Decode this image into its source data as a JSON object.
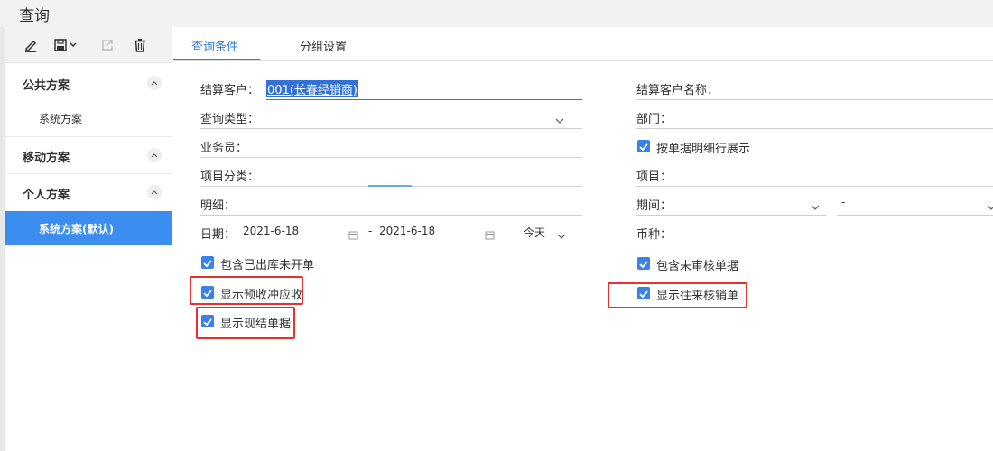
{
  "window": {
    "title": "查询"
  },
  "toolbar": {
    "icons": [
      "edit-icon",
      "save-icon",
      "export-icon",
      "delete-icon"
    ]
  },
  "sidebar": {
    "groups": [
      {
        "label": "公共方案",
        "items": [
          "系统方案"
        ]
      },
      {
        "label": "移动方案",
        "items": []
      },
      {
        "label": "个人方案",
        "items": [
          "系统方案(默认)"
        ]
      }
    ],
    "active_item": "系统方案(默认)"
  },
  "tabs": [
    {
      "label": "查询条件",
      "active": true
    },
    {
      "label": "分组设置",
      "active": false
    }
  ],
  "left_fields": {
    "customer": {
      "label": "结算客户：",
      "value": "001(长春经销商)"
    },
    "query_type": {
      "label": "查询类型：",
      "value": ""
    },
    "salesperson": {
      "label": "业务员：",
      "value": ""
    },
    "project_category": {
      "label": "项目分类：",
      "value": ""
    },
    "detail": {
      "label": "明细：",
      "value": ""
    },
    "date": {
      "label": "日期：",
      "from": "2021-6-18",
      "sep": "-",
      "to": "2021-6-18",
      "preset": "今天"
    }
  },
  "right_fields": {
    "customer_name": {
      "label": "结算客户名称："
    },
    "department": {
      "label": "部门："
    },
    "show_by_detail": {
      "label": "按单据明细行展示",
      "checked": true
    },
    "project": {
      "label": "项目："
    },
    "period": {
      "label": "期间：",
      "sep": "-"
    },
    "currency": {
      "label": "币种："
    }
  },
  "checkboxes_left": [
    {
      "label": "包含已出库未开单",
      "checked": true
    },
    {
      "label": "显示预收冲应收",
      "checked": true
    },
    {
      "label": "显示现结单据",
      "checked": true
    }
  ],
  "checkboxes_right": [
    {
      "label": "包含未审核单据",
      "checked": true
    },
    {
      "label": "显示往来核销单",
      "checked": true
    }
  ],
  "colors": {
    "accent": "#2d7ad8",
    "active_bg": "#3b8ef0",
    "highlight": "#e8312a",
    "checkbox": "#3b82e6"
  }
}
